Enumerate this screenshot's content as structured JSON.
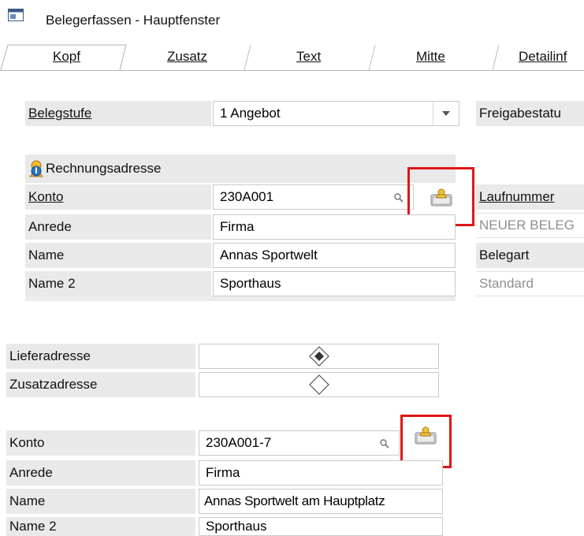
{
  "window": {
    "title": "Belegerfassen - Hauptfenster"
  },
  "tabs": [
    {
      "label": "Kopf"
    },
    {
      "label": "Zusatz"
    },
    {
      "label": "Text"
    },
    {
      "label": "Mitte"
    },
    {
      "label": "Detailinf"
    }
  ],
  "belegstufe": {
    "label": "Belegstufe",
    "value": "1 Angebot"
  },
  "freigabestatus": {
    "label": "Freigabestatu"
  },
  "rechnungsadresse": {
    "header": "Rechnungsadresse",
    "konto": {
      "label": "Konto",
      "value": "230A001"
    },
    "anrede": {
      "label": "Anrede",
      "value": "Firma"
    },
    "name": {
      "label": "Name",
      "value": "Annas Sportwelt"
    },
    "name2": {
      "label": "Name 2",
      "value": "Sporthaus"
    }
  },
  "right_panel": {
    "laufnummer_label": "Laufnummer",
    "laufnummer_value": "NEUER BELEG",
    "belegart_label": "Belegart",
    "belegart_value": "Standard"
  },
  "address_type": {
    "lieferadresse": {
      "label": "Lieferadresse",
      "checked": true
    },
    "zusatzadresse": {
      "label": "Zusatzadresse",
      "checked": false
    }
  },
  "lieferadresse_block": {
    "konto": {
      "label": "Konto",
      "value": "230A001-7"
    },
    "anrede": {
      "label": "Anrede",
      "value": "Firma"
    },
    "name": {
      "label": "Name",
      "value": "Annas Sportwelt am Hauptplatz"
    },
    "name2": {
      "label": "Name 2",
      "value": "Sporthaus"
    }
  },
  "icons": {
    "app": "window-icon",
    "address_book": "address-book-icon",
    "search": "magnifier-icon",
    "address_info": "address-info-icon",
    "dropdown": "chevron-down-icon"
  },
  "colors": {
    "highlight": "#e01616",
    "label_bg": "#e9e9e9"
  }
}
